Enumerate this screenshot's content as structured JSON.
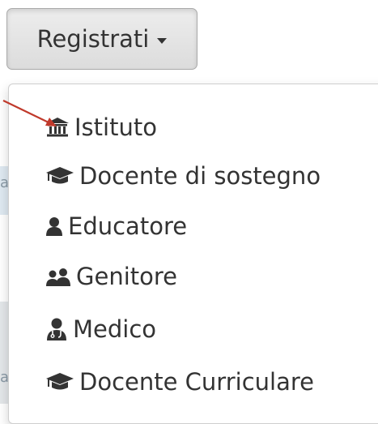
{
  "button": {
    "label": "Registrati",
    "caret_icon": "caret-down-icon"
  },
  "menu": {
    "items": [
      {
        "label": "Istituto",
        "icon": "institution-icon"
      },
      {
        "label": "Docente di sostegno",
        "icon": "graduation-cap-icon"
      },
      {
        "label": "Educatore",
        "icon": "user-icon"
      },
      {
        "label": "Genitore",
        "icon": "users-icon"
      },
      {
        "label": "Medico",
        "icon": "user-md-icon"
      },
      {
        "label": "Docente Curriculare",
        "icon": "graduation-cap-icon"
      }
    ]
  },
  "annotation": {
    "arrow_color": "#c0392b"
  }
}
